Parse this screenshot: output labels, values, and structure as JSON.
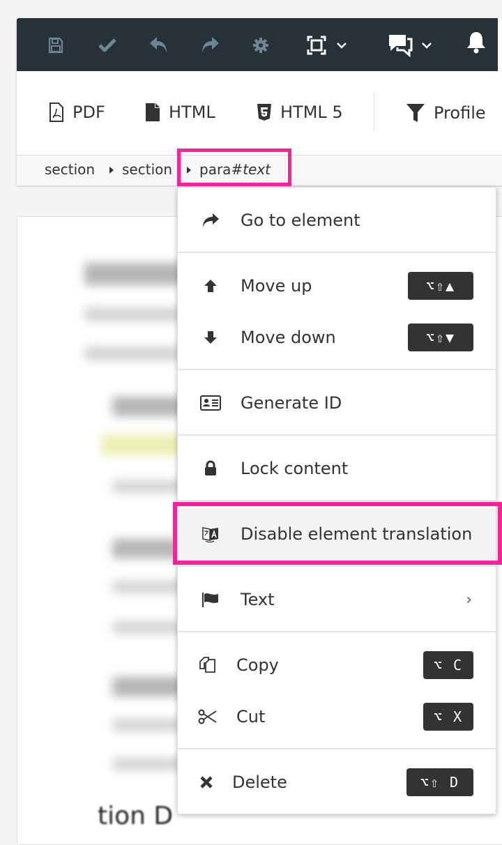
{
  "toolbar": {
    "icons": [
      {
        "name": "save-icon",
        "state": "disabled"
      },
      {
        "name": "check-icon",
        "state": "disabled"
      },
      {
        "name": "undo-icon",
        "state": "disabled"
      },
      {
        "name": "redo-icon",
        "state": "disabled"
      },
      {
        "name": "gear-icon",
        "state": "disabled"
      },
      {
        "name": "fullscreen-icon",
        "state": "enabled",
        "dropdown": true
      },
      {
        "name": "comments-icon",
        "state": "enabled",
        "dropdown": true
      },
      {
        "name": "bell-icon",
        "state": "enabled"
      }
    ],
    "colors": {
      "background": "#263238",
      "disabled_icon": "#6f8795",
      "enabled_icon": "#ffffff"
    }
  },
  "publish_bar": {
    "items": [
      {
        "label": "PDF",
        "icon": "pdf-file-icon"
      },
      {
        "label": "HTML",
        "icon": "file-icon"
      },
      {
        "label": "HTML 5",
        "icon": "html5-icon"
      },
      {
        "label": "Profile",
        "icon": "filter-icon"
      }
    ]
  },
  "breadcrumb": {
    "items": [
      {
        "label": "section"
      },
      {
        "label": "section"
      },
      {
        "label": "para",
        "id_label": "#text",
        "highlighted": true
      }
    ]
  },
  "document": {
    "partial_visible_text": "tion D"
  },
  "context_menu": {
    "items": [
      {
        "label": "Go to element",
        "icon": "share-arrow-icon"
      },
      {
        "label": "Move up",
        "icon": "arrow-up-icon",
        "shortcut": "⌥⇧▲"
      },
      {
        "label": "Move down",
        "icon": "arrow-down-icon",
        "shortcut": "⌥⇧▼"
      },
      {
        "label": "Generate ID",
        "icon": "id-card-icon"
      },
      {
        "label": "Lock content",
        "icon": "lock-icon"
      },
      {
        "label": "Disable element translation",
        "icon": "translate-icon",
        "highlighted": true
      },
      {
        "label": "Text",
        "icon": "flag-icon",
        "submenu": "›"
      },
      {
        "label": "Copy",
        "icon": "copy-icon",
        "shortcut": "⌥ C"
      },
      {
        "label": "Cut",
        "icon": "scissors-icon",
        "shortcut": "⌥ X"
      },
      {
        "label": "Delete",
        "icon": "close-icon",
        "shortcut": "⌥⇧ D"
      }
    ]
  },
  "highlight_color": "#ff1f9a"
}
